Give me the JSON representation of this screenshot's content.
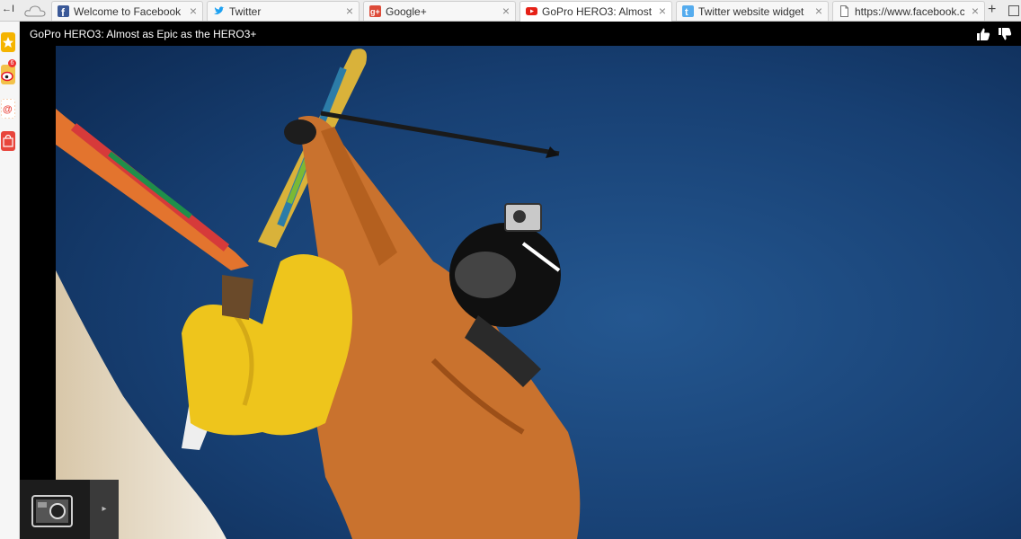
{
  "browser": {
    "left_marker": "←I",
    "tabs": [
      {
        "title": "Welcome to Facebook",
        "icon": "facebook-icon",
        "color": "#3b5998",
        "active": false
      },
      {
        "title": "Twitter",
        "icon": "twitter-icon",
        "color": "#1da1f2",
        "active": false
      },
      {
        "title": "Google+",
        "icon": "google-plus-icon",
        "color": "#dd4b39",
        "active": false
      },
      {
        "title": "GoPro HERO3: Almost",
        "icon": "youtube-icon",
        "color": "#e62117",
        "active": true
      },
      {
        "title": "Twitter website widget",
        "icon": "twitter-icon",
        "color": "#55acee",
        "active": false
      },
      {
        "title": "https://www.facebook.c",
        "icon": "page-icon",
        "color": "#888888",
        "active": false
      }
    ],
    "close_glyph": "×",
    "new_tab_glyph": "+"
  },
  "sidebar": {
    "items": [
      {
        "icon": "star-icon",
        "color": "#f5b400"
      },
      {
        "icon": "weibo-icon",
        "color": "#e6162d"
      },
      {
        "icon": "mail-icon",
        "color": "#f06a35"
      },
      {
        "icon": "shopping-bag-icon",
        "color": "#e8453c"
      }
    ],
    "badge": "6"
  },
  "video": {
    "title": "GoPro HERO3: Almost as Epic as the HERO3+",
    "like_icon": "thumbs-up-icon",
    "dislike_icon": "thumbs-down-icon",
    "next_icon": "play-arrow-icon",
    "next_glyph": "▸"
  }
}
